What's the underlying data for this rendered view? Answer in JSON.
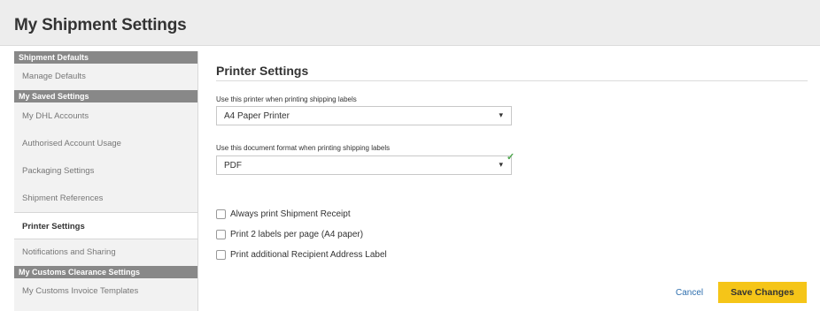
{
  "header": {
    "title": "My Shipment Settings"
  },
  "sidebar": {
    "sections": [
      {
        "heading": "Shipment Defaults",
        "items": [
          "Manage Defaults"
        ]
      },
      {
        "heading": "My Saved Settings",
        "items": [
          "My DHL Accounts",
          "Authorised Account Usage",
          "Packaging Settings",
          "Shipment References",
          "Printer Settings",
          "Notifications and Sharing"
        ]
      },
      {
        "heading": "My Customs Clearance Settings",
        "items": [
          "My Customs Invoice Templates"
        ]
      }
    ],
    "selected": "Printer Settings"
  },
  "main": {
    "title": "Printer Settings",
    "printer": {
      "label": "Use this printer when printing shipping labels",
      "value": "A4 Paper Printer"
    },
    "format": {
      "label": "Use this document format when printing shipping labels",
      "value": "PDF"
    },
    "options": [
      {
        "label": "Always print Shipment Receipt",
        "checked": false
      },
      {
        "label": "Print 2 labels per page (A4 paper)",
        "checked": false
      },
      {
        "label": "Print additional Recipient Address Label",
        "checked": false
      }
    ]
  },
  "actions": {
    "cancel": "Cancel",
    "save": "Save Changes"
  },
  "colors": {
    "accent": "#f5c518",
    "link": "#2e6fae",
    "valid": "#4ca64c",
    "sidebar_heading": "#888888"
  },
  "icons": {
    "dropdown": "dropdown-arrow-icon",
    "valid": "checkmark-icon"
  }
}
